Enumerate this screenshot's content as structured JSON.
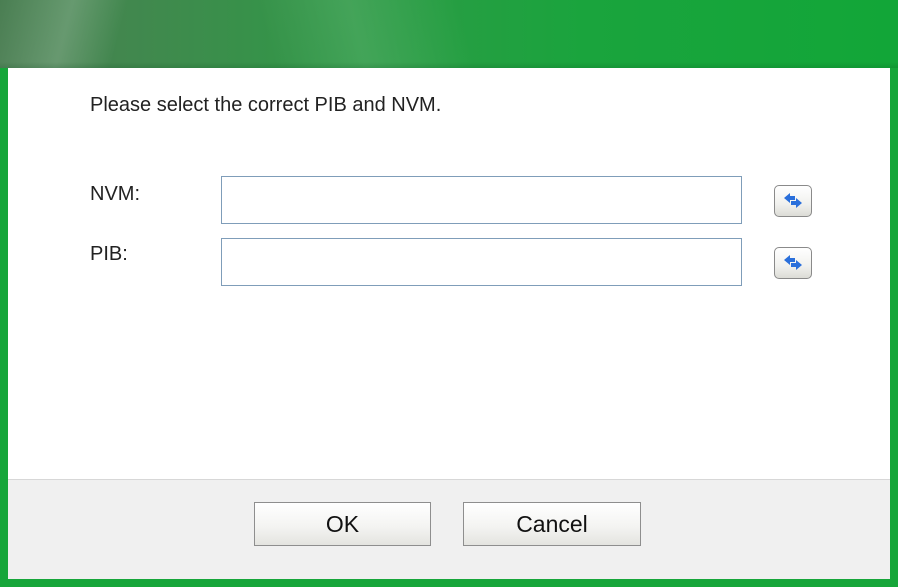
{
  "dialog": {
    "prompt": "Please select the correct PIB and NVM.",
    "fields": {
      "nvm": {
        "label": "NVM:",
        "value": "",
        "swap_icon": "swap-arrows-icon"
      },
      "pib": {
        "label": "PIB:",
        "value": "",
        "swap_icon": "swap-arrows-icon"
      }
    },
    "buttons": {
      "ok_label": "OK",
      "cancel_label": "Cancel"
    }
  },
  "colors": {
    "frame_green": "#16a63a",
    "titlebar_dark": "#4a7e52",
    "input_border": "#7f9db9",
    "icon_blue": "#2a6fdb",
    "footer_bg": "#f0f0f0"
  }
}
